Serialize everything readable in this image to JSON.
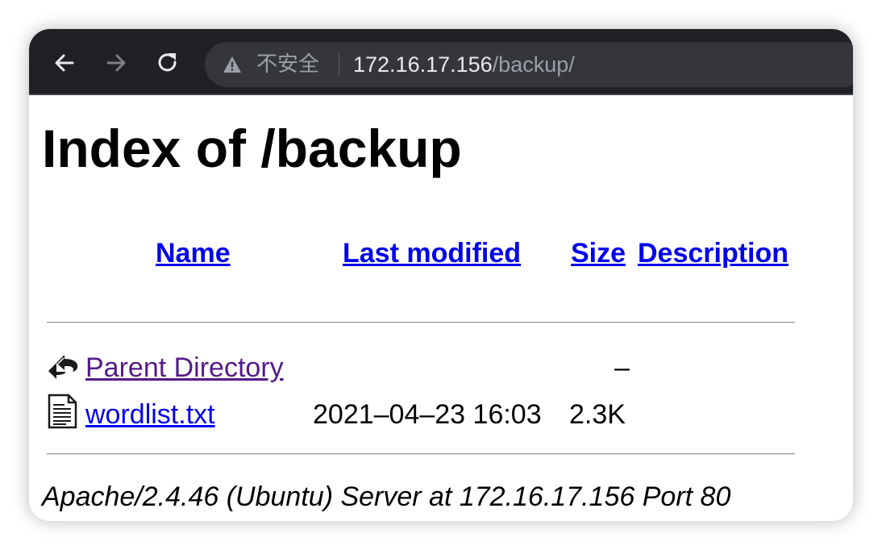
{
  "browser": {
    "security_label": "不安全",
    "url_host": "172.16.17.156",
    "url_path": "/backup/"
  },
  "page": {
    "title": "Index of /backup",
    "columns": {
      "name": "Name",
      "last_modified": "Last modified",
      "size": "Size",
      "description": "Description"
    },
    "rows": [
      {
        "icon": "back-arrow-icon",
        "name": "Parent Directory",
        "last_modified": "",
        "size": "–",
        "description": ""
      },
      {
        "icon": "text-file-icon",
        "name": "wordlist.txt",
        "last_modified": "2021–04–23 16:03",
        "size": "2.3K",
        "description": ""
      }
    ],
    "server_signature": "Apache/2.4.46 (Ubuntu) Server at 172.16.17.156 Port 80"
  },
  "colors": {
    "toolbar": "#202124",
    "omnibox": "#35363a",
    "link": "#0000ee",
    "visited_link": "#551a8b"
  }
}
